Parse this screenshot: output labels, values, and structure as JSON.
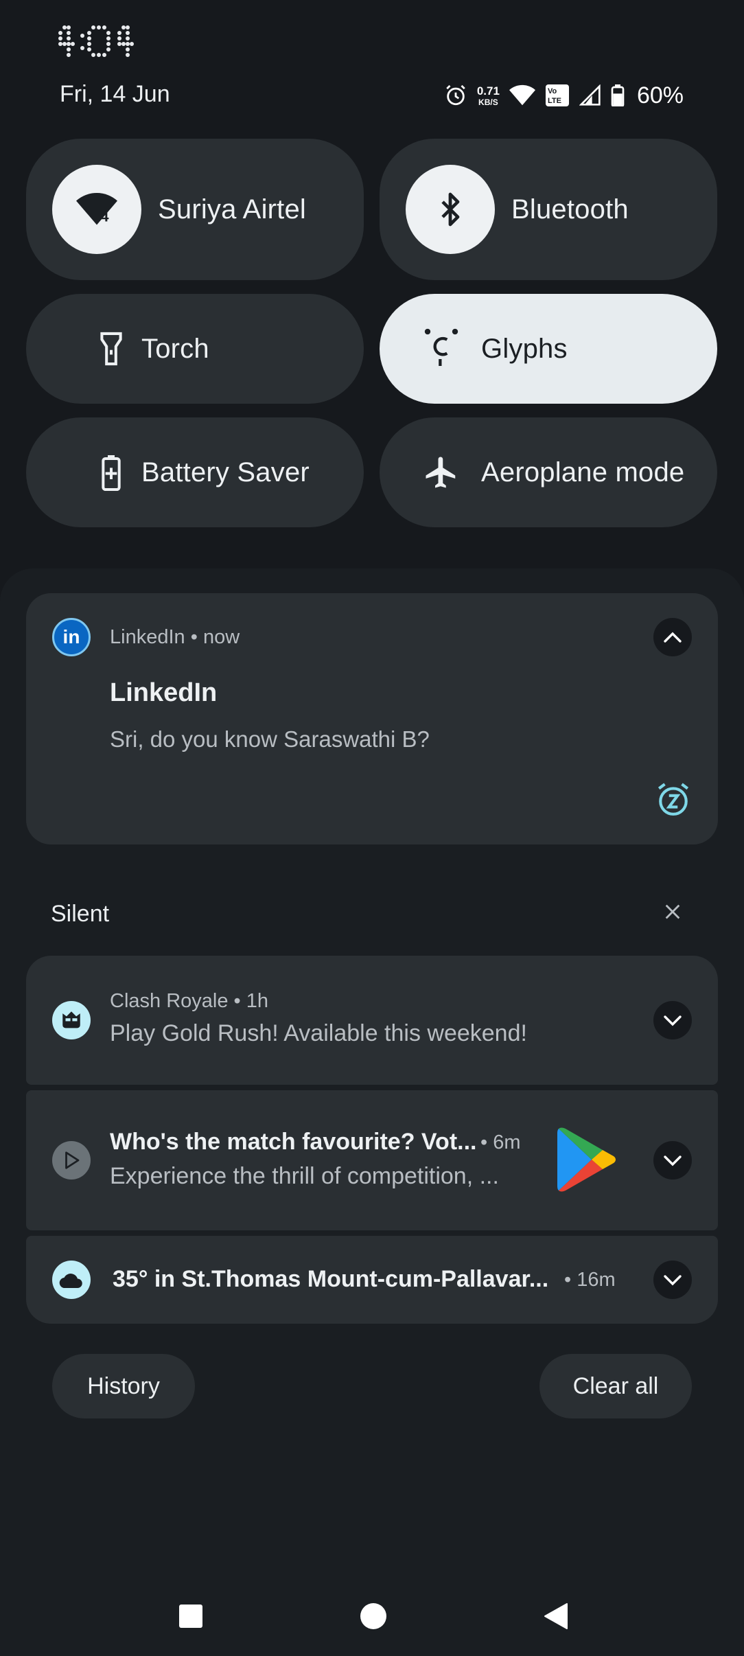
{
  "status_bar": {
    "time": "4:04",
    "date": "Fri, 14 Jun",
    "net_speed_value": "0.71",
    "net_speed_unit": "KB/S",
    "volte_line1": "Vo",
    "volte_line2": "LTE",
    "battery_percent": "60%"
  },
  "quick_settings": {
    "wifi": {
      "label": "Suriya Airtel",
      "badge": "4"
    },
    "bluetooth": {
      "label": "Bluetooth"
    },
    "torch": {
      "label": "Torch"
    },
    "glyphs": {
      "label": "Glyphs",
      "active": true
    },
    "battery_saver": {
      "label": "Battery Saver"
    },
    "aeroplane": {
      "label": "Aeroplane mode"
    }
  },
  "notifications": {
    "linkedin": {
      "app": "LinkedIn",
      "time": "now",
      "title": "LinkedIn",
      "text": "Sri, do you know Saraswathi B?"
    },
    "silent_header": "Silent",
    "clash": {
      "app": "Clash Royale",
      "time": "1h",
      "text": "Play Gold Rush! Available this weekend!"
    },
    "play": {
      "title": "Who's the match favourite? Vot...",
      "time": "6m",
      "text": "Experience the thrill of competition, ..."
    },
    "weather": {
      "title": "35° in St.Thomas Mount-cum-Pallavar...",
      "time": "16m"
    }
  },
  "footer": {
    "history": "History",
    "clear_all": "Clear all"
  },
  "colors": {
    "accent": "#7fd8e8",
    "linkedin": "#0a66c2",
    "tile": "#2a2f33",
    "tile_active": "#e7ecef"
  }
}
